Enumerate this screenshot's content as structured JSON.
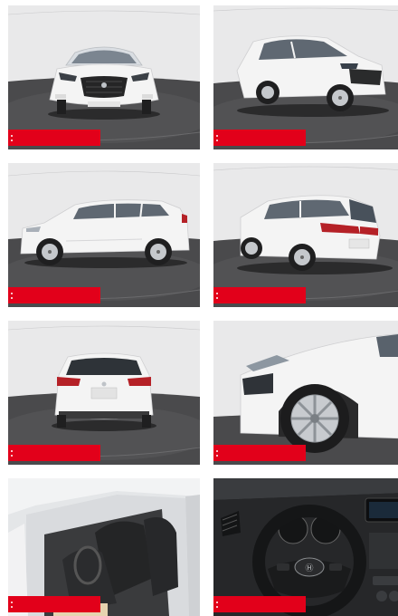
{
  "gallery": {
    "photos": [
      {
        "view": "front",
        "badge": ""
      },
      {
        "view": "front-right-three-quarter",
        "badge": ""
      },
      {
        "view": "left-side",
        "badge": ""
      },
      {
        "view": "rear-left-three-quarter",
        "badge": ""
      },
      {
        "view": "rear",
        "badge": ""
      },
      {
        "view": "front-wheel-detail",
        "badge": ""
      },
      {
        "view": "front-seats-interior",
        "badge": ""
      },
      {
        "view": "steering-wheel-dashboard",
        "badge": ""
      }
    ]
  },
  "colors": {
    "badge_red": "#e2001a",
    "car_body": "#f4f4f4",
    "turntable": "#4a4a4c",
    "studio_wall": "#e9e9ea"
  }
}
